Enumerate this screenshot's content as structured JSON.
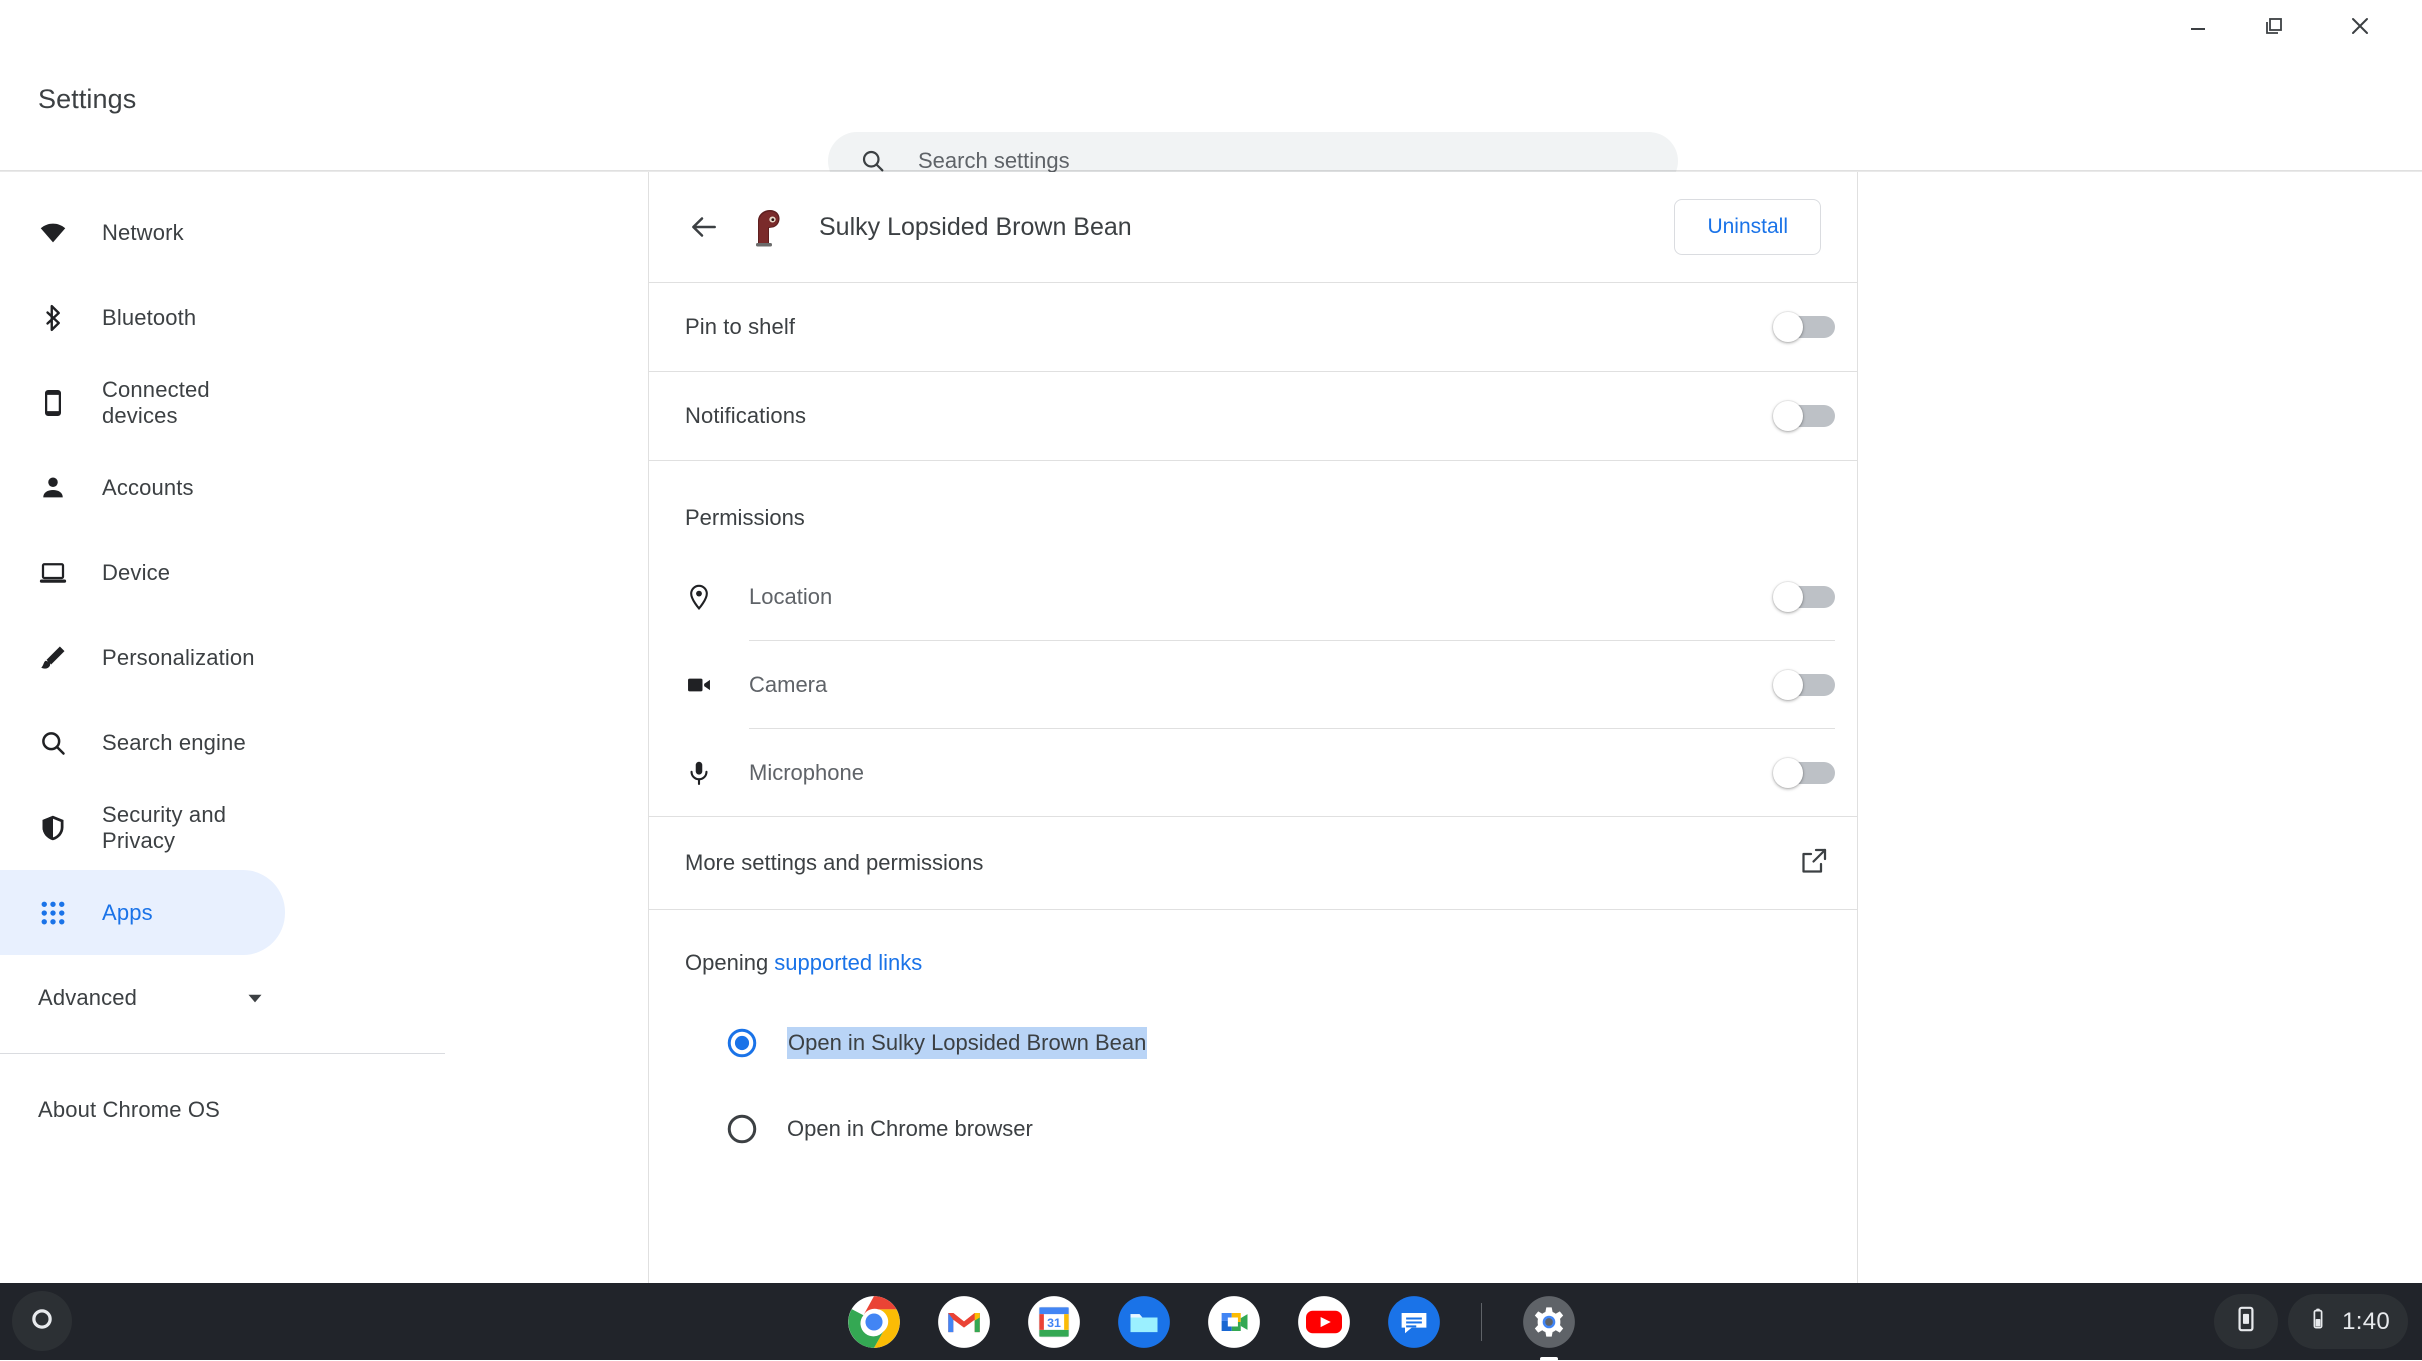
{
  "window": {
    "controls": [
      {
        "name": "minimize",
        "glyph": "minimize-icon"
      },
      {
        "name": "restore",
        "glyph": "restore-icon"
      },
      {
        "name": "close",
        "glyph": "close-icon"
      }
    ]
  },
  "header": {
    "title": "Settings",
    "search": {
      "placeholder": "Search settings",
      "value": "",
      "icon": "search-icon"
    }
  },
  "sidebar": {
    "items": [
      {
        "label": "Network",
        "icon": "wifi-icon",
        "selected": false
      },
      {
        "label": "Bluetooth",
        "icon": "bluetooth-icon",
        "selected": false
      },
      {
        "label": "Connected devices",
        "icon": "phone-icon",
        "selected": false
      },
      {
        "label": "Accounts",
        "icon": "person-icon",
        "selected": false
      },
      {
        "label": "Device",
        "icon": "laptop-icon",
        "selected": false
      },
      {
        "label": "Personalization",
        "icon": "brush-icon",
        "selected": false
      },
      {
        "label": "Search engine",
        "icon": "search-icon",
        "selected": false
      },
      {
        "label": "Security and Privacy",
        "icon": "shield-icon",
        "selected": false
      },
      {
        "label": "Apps",
        "icon": "apps-grid-icon",
        "selected": true
      }
    ],
    "advanced": {
      "label": "Advanced",
      "icon": "chevron-down-icon"
    },
    "about": {
      "label": "About Chrome OS"
    }
  },
  "main": {
    "app_header": {
      "back_icon": "back-arrow-icon",
      "app_icon": "app-avatar-icon",
      "app_name": "Sulky Lopsided Brown Bean",
      "uninstall_label": "Uninstall"
    },
    "toggle_rows": [
      {
        "label": "Pin to shelf",
        "state": "off"
      },
      {
        "label": "Notifications",
        "state": "off"
      }
    ],
    "permissions": {
      "heading": "Permissions",
      "rows": [
        {
          "label": "Location",
          "icon": "location-pin-icon",
          "state": "off"
        },
        {
          "label": "Camera",
          "icon": "camera-icon",
          "state": "off"
        },
        {
          "label": "Microphone",
          "icon": "microphone-icon",
          "state": "off"
        }
      ]
    },
    "more_settings": {
      "label": "More settings and permissions",
      "icon": "open-in-new-icon"
    },
    "opening": {
      "prefix": "Opening ",
      "link": "supported links",
      "options": [
        {
          "label": "Open in Sulky Lopsided Brown Bean",
          "selected": true,
          "text_highlighted": true
        },
        {
          "label": "Open in Chrome browser",
          "selected": false,
          "text_highlighted": false
        }
      ]
    }
  },
  "shelf": {
    "launcher_icon": "launcher-circle-icon",
    "apps": [
      {
        "name": "chrome",
        "label": "Chrome"
      },
      {
        "name": "gmail",
        "label": "Gmail"
      },
      {
        "name": "calendar",
        "label": "Calendar",
        "day": "31"
      },
      {
        "name": "files",
        "label": "Files"
      },
      {
        "name": "meet",
        "label": "Meet"
      },
      {
        "name": "youtube",
        "label": "YouTube"
      },
      {
        "name": "chat",
        "label": "Chat"
      },
      {
        "name": "settings",
        "label": "Settings",
        "active": true
      }
    ],
    "status": {
      "device_icon": "phone-hub-icon",
      "battery_icon": "battery-icon",
      "clock": "1:40"
    }
  },
  "colors": {
    "accent": "#1a73e8",
    "selected_bg": "#e8f0fe",
    "text_primary": "#3c4043",
    "text_secondary": "#5f6368",
    "divider": "#e0e0e0",
    "shelf_bg": "#21242a",
    "selection_highlight": "#b9d4f6",
    "toggle_track_off": "#bdc1c6"
  }
}
